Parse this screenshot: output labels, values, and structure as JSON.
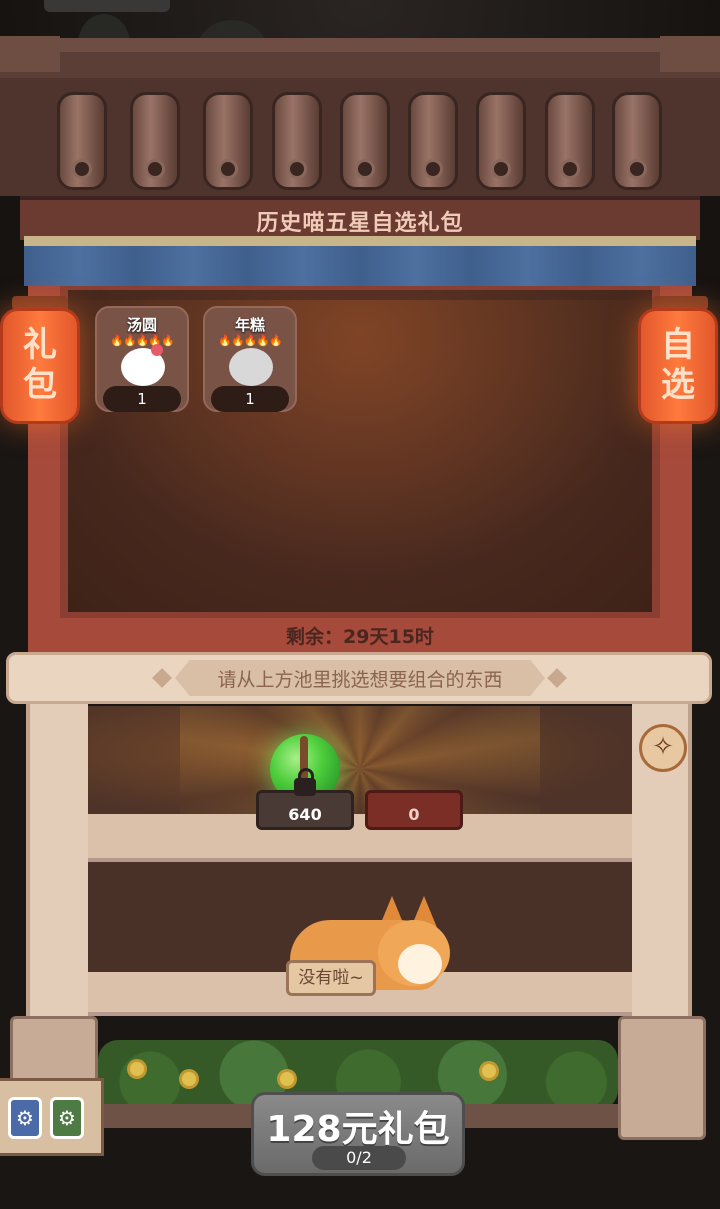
{
  "shop": {
    "title": "历史喵五星自选礼包",
    "remaining": "剩余：29天15时"
  },
  "lanterns": {
    "left": {
      "line1": "礼",
      "line2": "包"
    },
    "right": {
      "line1": "自",
      "line2": "选"
    }
  },
  "pool": {
    "items": [
      {
        "name": "汤圆",
        "stars": "🔥🔥🔥🔥🔥",
        "count": "1",
        "icon": "white-cat-icon"
      },
      {
        "name": "年糕",
        "stars": "🔥🔥🔥🔥🔥",
        "count": "1",
        "icon": "gray-cat-icon"
      }
    ]
  },
  "banner": {
    "text": "请从上方池里挑选想要组合的东西"
  },
  "shelf": {
    "slot1_value": "640",
    "slot2_value": "0",
    "empty_sign": "没有啦~",
    "clean_icon": "broom-icon"
  },
  "side_panel": {
    "chip1_icon": "gear-icon",
    "chip2_icon": "gear-icon"
  },
  "purchase": {
    "label": "128元礼包",
    "progress": "0/2"
  }
}
